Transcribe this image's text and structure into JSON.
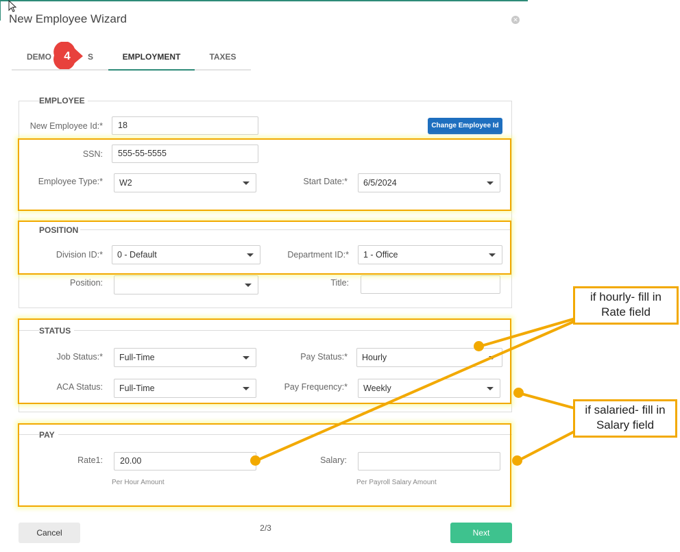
{
  "dialog": {
    "title": "New Employee Wizard",
    "close_icon": "close-icon"
  },
  "tabs": [
    {
      "label": "DEMOGRAPHICS",
      "visible_text_left": "DEMO",
      "visible_text_right": "S"
    },
    {
      "label": "EMPLOYMENT",
      "active": true
    },
    {
      "label": "TAXES"
    }
  ],
  "step_badge": "4",
  "employee": {
    "section_title": "EMPLOYEE",
    "new_id_label": "New Employee Id:*",
    "new_id_value": "18",
    "change_button": "Change Employee Id",
    "ssn_label": "SSN:",
    "ssn_value": "555-55-5555",
    "type_label": "Employee Type:*",
    "type_value": "W2",
    "start_label": "Start Date:*",
    "start_value": "6/5/2024"
  },
  "position": {
    "section_title": "POSITION",
    "division_label": "Division ID:*",
    "division_value": "0 - Default",
    "department_label": "Department ID:*",
    "department_value": "1 - Office",
    "position_label": "Position:",
    "position_value": "",
    "title_label": "Title:",
    "title_value": ""
  },
  "status": {
    "section_title": "STATUS",
    "job_label": "Job Status:*",
    "job_value": "Full-Time",
    "pay_status_label": "Pay Status:*",
    "pay_status_value": "Hourly",
    "aca_label": "ACA Status:",
    "aca_value": "Full-Time",
    "frequency_label": "Pay Frequency:*",
    "frequency_value": "Weekly"
  },
  "pay": {
    "section_title": "PAY",
    "rate_label": "Rate1:",
    "rate_value": "20.00",
    "rate_hint": "Per Hour Amount",
    "salary_label": "Salary:",
    "salary_value": "",
    "salary_hint": "Per Payroll Salary Amount"
  },
  "footer": {
    "cancel": "Cancel",
    "page": "2/3",
    "next": "Next"
  },
  "callouts": {
    "hourly_line1": "if hourly- fill in",
    "hourly_line2": "Rate field",
    "salaried_line1": "if salaried- fill in",
    "salaried_line2": "Salary field"
  },
  "colors": {
    "accent": "#2e8b78",
    "highlight": "#f2a900",
    "next_button": "#3ec28e",
    "change_button": "#1e6fbf",
    "badge": "#e8413c"
  }
}
